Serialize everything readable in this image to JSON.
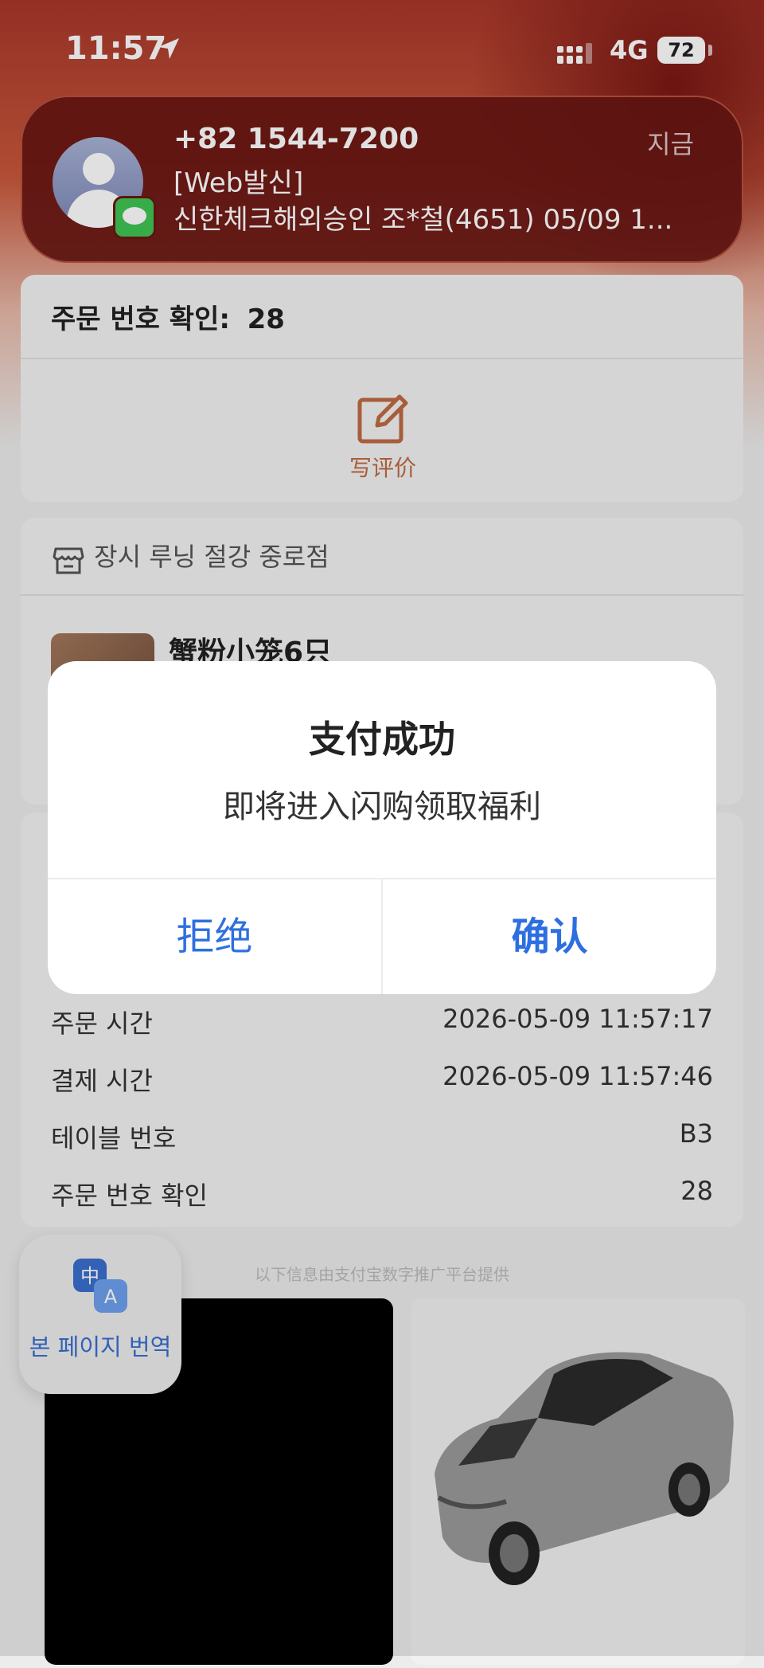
{
  "status_bar": {
    "time": "11:57",
    "network": "4G",
    "battery": "72"
  },
  "notification": {
    "sender": "+82 1544-7200",
    "time": "지금",
    "line1": "[Web발신]",
    "line2": "신한체크해외승인 조*철(4651) 05/09 1..."
  },
  "order_card": {
    "label": "주문 번호 확인:",
    "value": "28",
    "review_label": "写评价"
  },
  "store": {
    "name": "장시 루닝 절강 중로점",
    "item_title": "蟹粉小笼6只"
  },
  "details": {
    "rows": [
      {
        "label": "주문 시간",
        "value": "2026-05-09 11:57:17"
      },
      {
        "label": "결제 시간",
        "value": "2026-05-09 11:57:46"
      },
      {
        "label": "테이블 번호",
        "value": "B3"
      },
      {
        "label": "주문 번호 확인",
        "value": "28"
      }
    ]
  },
  "promo": {
    "caption": "以下信息由支付宝数字推广平台提供"
  },
  "translate": {
    "label": "본 페이지 번역"
  },
  "dialog": {
    "title": "支付成功",
    "message": "即将进入闪购领取福利",
    "reject_label": "拒绝",
    "confirm_label": "确认"
  },
  "colors": {
    "accent": "#2d6fe0",
    "review": "#c06a44",
    "notification_bg": "#681612"
  }
}
